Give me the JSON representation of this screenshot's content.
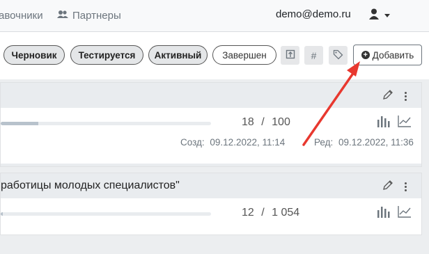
{
  "nav": {
    "references_partial": "авочники",
    "partners": "Партнеры"
  },
  "user": {
    "email": "demo@demo.ru"
  },
  "filters": {
    "statuses": [
      "Черновик",
      "Тестируется",
      "Активный",
      "Завершен"
    ],
    "icon_buttons": [
      "upload-icon",
      "hash-icon",
      "tag-icon"
    ],
    "add_label": "Добавить"
  },
  "cards": [
    {
      "title": "",
      "progress": 0.18,
      "count": "18",
      "total": "100",
      "created_label": "Созд:",
      "created": "09.12.2022, 11:14",
      "edited_label": "Ред:",
      "edited": "09.12.2022, 11:36"
    },
    {
      "title": "работицы молодых специалистов\"",
      "progress": 0.011,
      "count": "12",
      "total": "1 054"
    }
  ],
  "separator": "/",
  "colors": {
    "arrow": "#e8382f",
    "accent": "#333333"
  }
}
